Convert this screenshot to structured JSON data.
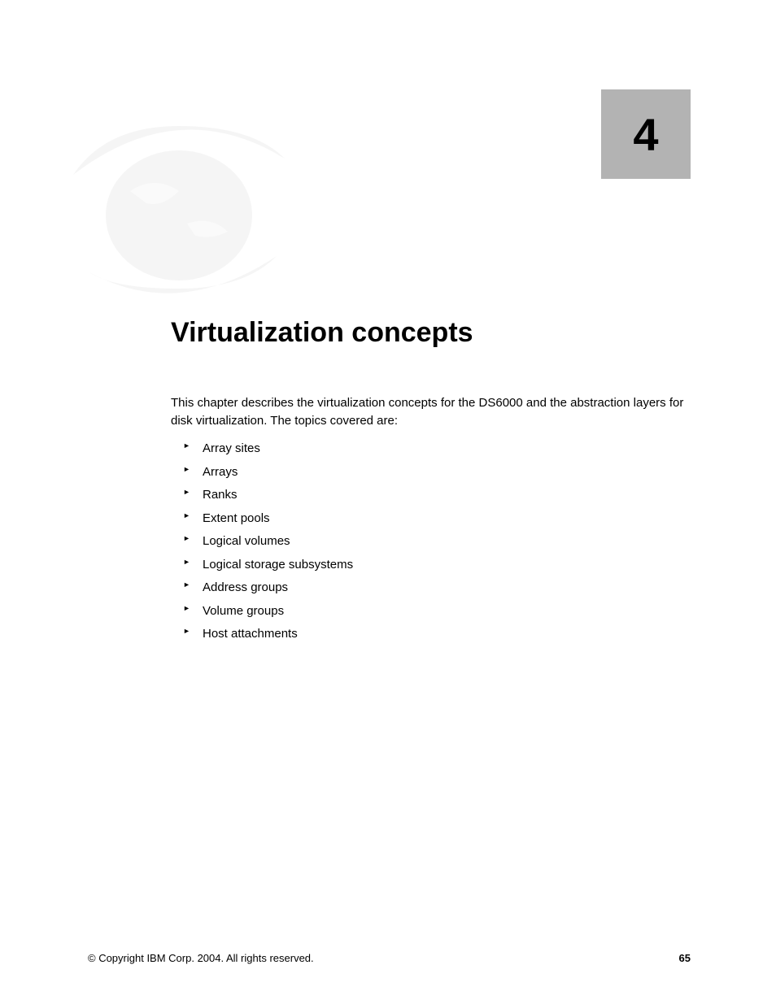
{
  "chapter": {
    "number": "4",
    "title": "Virtualization concepts"
  },
  "intro": "This chapter describes the virtualization concepts for the DS6000 and the abstraction layers for disk virtualization. The topics covered are:",
  "bullets": [
    "Array sites",
    "Arrays",
    "Ranks",
    "Extent pools",
    "Logical volumes",
    "Logical storage subsystems",
    "Address groups",
    "Volume groups",
    "Host attachments"
  ],
  "footer": {
    "copyright": "© Copyright IBM Corp. 2004. All rights reserved.",
    "page": "65"
  }
}
